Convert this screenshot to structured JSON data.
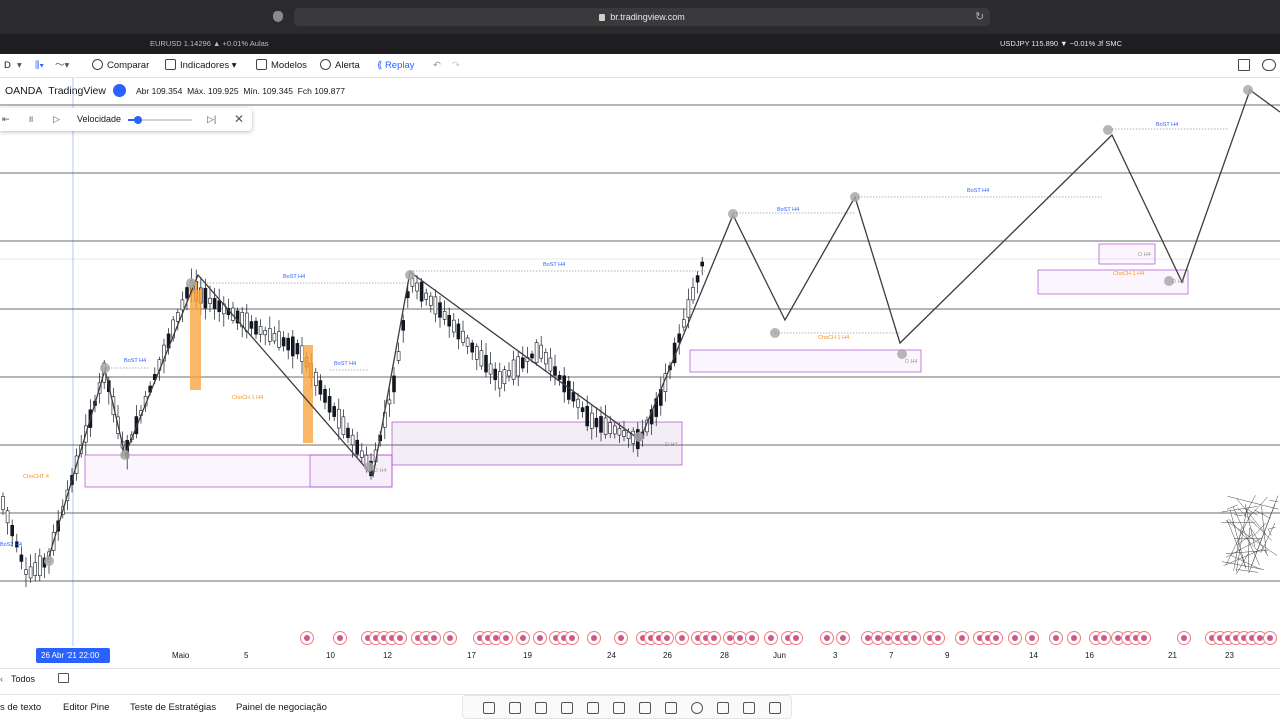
{
  "browser": {
    "url": "br.tradingview.com"
  },
  "tickers": {
    "left": "EURUSD 1.14296 ▲ +0.01% Aulas",
    "right": "USDJPY 115.890 ▼ −0.01% Jf SMC"
  },
  "toolbar": {
    "interval": "D",
    "compare": "Comparar",
    "indicators": "Indicadores",
    "templates": "Modelos",
    "alert": "Alerta",
    "replay": "Replay"
  },
  "legend": {
    "symbol": "OANDA",
    "source": "TradingView",
    "open": "Abr 109.354",
    "high": "Máx. 109.925",
    "low": "Mín. 109.345",
    "close": "Fch 109.877"
  },
  "replay_panel": {
    "speed_label": "Velocidade",
    "speed_level": 0.15
  },
  "annotations": {
    "bost": "BoST H4",
    "choch": "ChoCH 1 H4",
    "chocht": "ChoCHT 4",
    "bos2": "BoS2 H4",
    "d_h4": "D H4",
    "o_h4": "O H4"
  },
  "time_axis": {
    "cursor_label": "26 Abr '21   22:00",
    "ticks": [
      "Maio",
      "5",
      "10",
      "12",
      "17",
      "19",
      "24",
      "26",
      "28",
      "Jun",
      "3",
      "7",
      "9",
      "14",
      "16",
      "21",
      "23"
    ]
  },
  "bottom_bar": {
    "scope": "Todos"
  },
  "bottom_tabs": [
    "s de texto",
    "Editor Pine",
    "Teste de Estratégias",
    "Painel de negociação"
  ],
  "colors": {
    "accent": "#2962ff",
    "bull": "#ffffff",
    "bear": "#131722",
    "highlight": "#f7a541",
    "zone": "#b04dd0",
    "label_blue": "#2962ff",
    "label_orange": "#f7931a"
  }
}
